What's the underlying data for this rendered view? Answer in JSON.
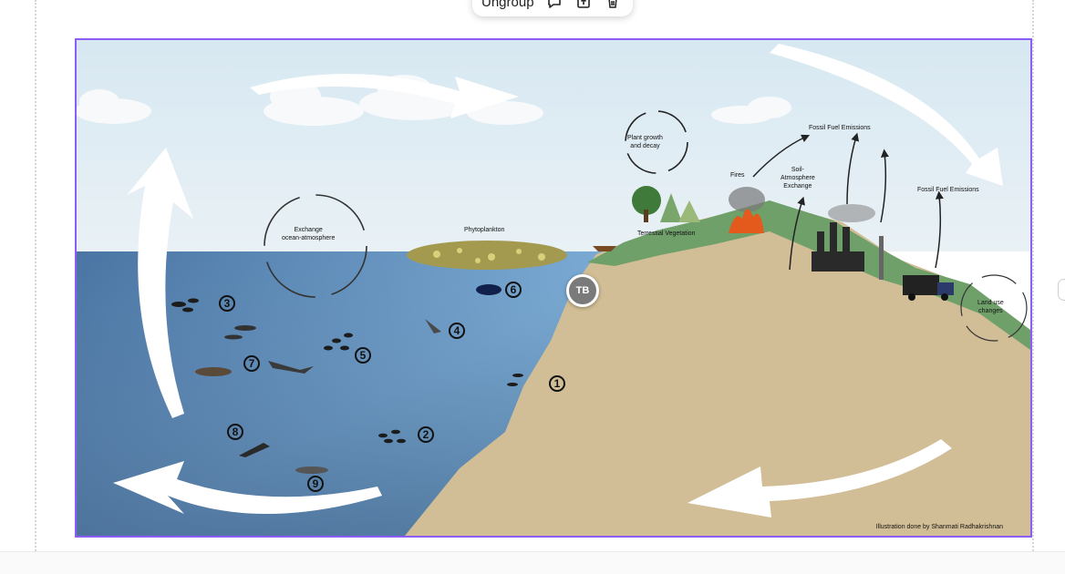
{
  "toolbar": {
    "ungroup_label": "Ungroup",
    "icons": [
      "comment-icon",
      "export-icon",
      "trash-icon"
    ]
  },
  "diagram": {
    "labels": {
      "plant_growth": "Plant growth\nand decay",
      "fossil_fuel_1": "Fossil Fuel Emissions",
      "fossil_fuel_2": "Fossil Fuel Emissions",
      "fires": "Fires",
      "soil_exchange": "Soil-\nAtmosphere\nExchange",
      "exchange_ocean": "Exchange\nocean-atmosphere",
      "phytoplankton": "Phytoplankton",
      "terrestrial": "Terrestial Vegetation",
      "land_use": "Land use\nchanges",
      "credit": "Illustration done by Shanmati Radhakrishnan"
    },
    "numbers": [
      "1",
      "2",
      "3",
      "4",
      "5",
      "6",
      "7",
      "8",
      "9"
    ]
  },
  "collaborator": {
    "initials": "TB"
  },
  "colors": {
    "selection": "#8b5cf6",
    "sky": "#dbe9f2",
    "ocean_light": "#8fbde0",
    "ocean_dark": "#3d6591",
    "land": "#d2be96",
    "grass": "#6fa06a"
  }
}
